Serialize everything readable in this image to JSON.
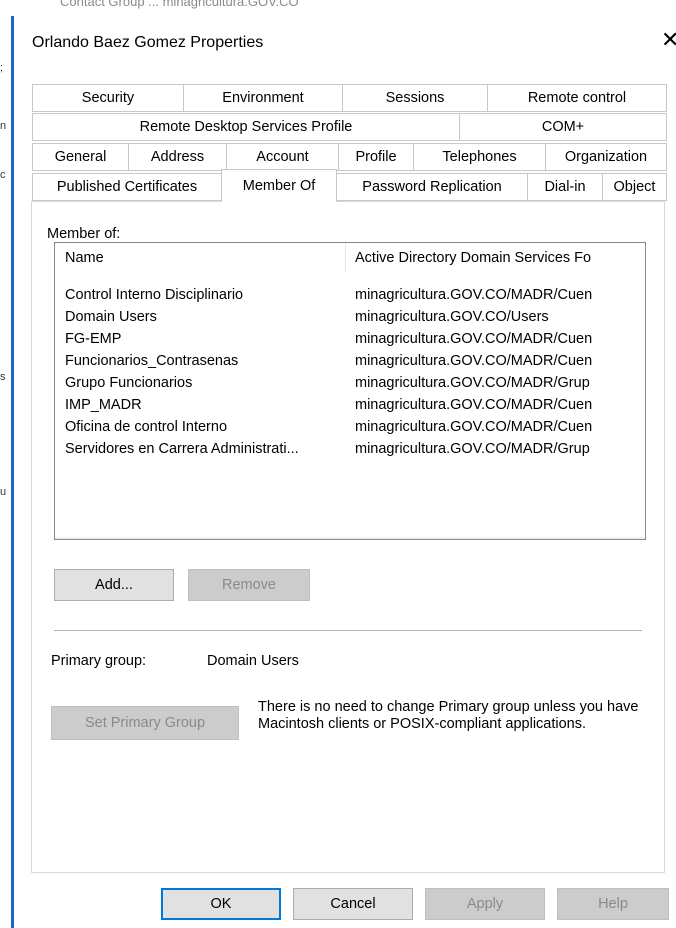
{
  "background": {
    "ghost_text": "Contact          Group          ...          minagricultura.GOV.CO",
    "left_fragments": [
      ";",
      "n",
      "c",
      "s",
      "u"
    ]
  },
  "dialog": {
    "title": "Orlando Baez Gomez Properties",
    "close_glyph": "✕"
  },
  "tabs": {
    "row1": [
      "Security",
      "Environment",
      "Sessions",
      "Remote control"
    ],
    "row2": [
      "Remote Desktop Services Profile",
      "COM+"
    ],
    "row3": [
      "General",
      "Address",
      "Account",
      "Profile",
      "Telephones",
      "Organization"
    ],
    "row4": [
      "Published Certificates",
      "Member Of",
      "Password Replication",
      "Dial-in",
      "Object"
    ],
    "active": "Member Of"
  },
  "member_of": {
    "label": "Member of:",
    "columns": [
      "Name",
      "Active Directory Domain Services Fo"
    ],
    "rows": [
      [
        "Control Interno Disciplinario",
        "minagricultura.GOV.CO/MADR/Cuen"
      ],
      [
        "Domain Users",
        "minagricultura.GOV.CO/Users"
      ],
      [
        "FG-EMP",
        "minagricultura.GOV.CO/MADR/Cuen"
      ],
      [
        "Funcionarios_Contrasenas",
        "minagricultura.GOV.CO/MADR/Cuen"
      ],
      [
        "Grupo Funcionarios",
        "minagricultura.GOV.CO/MADR/Grup"
      ],
      [
        "IMP_MADR",
        "minagricultura.GOV.CO/MADR/Cuen"
      ],
      [
        "Oficina de control Interno",
        "minagricultura.GOV.CO/MADR/Cuen"
      ],
      [
        "Servidores en Carrera Administrati...",
        "minagricultura.GOV.CO/MADR/Grup"
      ]
    ],
    "scroll_left": "<",
    "scroll_right": ">",
    "add_label": "Add...",
    "remove_label": "Remove"
  },
  "primary_group": {
    "label": "Primary group:",
    "value": "Domain Users",
    "set_button": "Set Primary Group",
    "note": "There is no need to change Primary group unless you have Macintosh clients or POSIX-compliant applications."
  },
  "footer": {
    "ok": "OK",
    "cancel": "Cancel",
    "apply": "Apply",
    "help": "Help"
  },
  "colors": {
    "accent": "#0078d7",
    "window_border": "#1e63c6"
  }
}
